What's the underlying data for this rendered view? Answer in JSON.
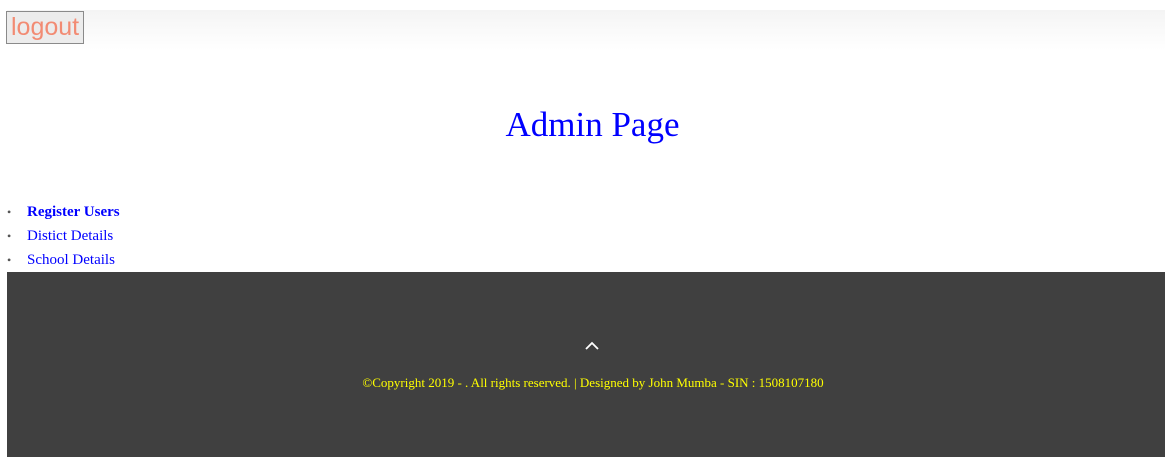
{
  "header": {
    "logout_label": "logout"
  },
  "main": {
    "title": "Admin Page"
  },
  "menu": {
    "items": [
      {
        "label": "Register Users",
        "active": true
      },
      {
        "label": "Distict Details",
        "active": false
      },
      {
        "label": "School Details",
        "active": false
      }
    ]
  },
  "footer": {
    "scroll_top_icon": "chevron-up-icon",
    "copyright": "©Copyright 2019 - . All rights reserved. | Designed by John Mumba - SIN : 1508107180"
  },
  "colors": {
    "title": "#0000ff",
    "links": "#0000ff",
    "logout_text": "#f28b73",
    "footer_bg": "#404040",
    "footer_text": "#ffff00"
  }
}
